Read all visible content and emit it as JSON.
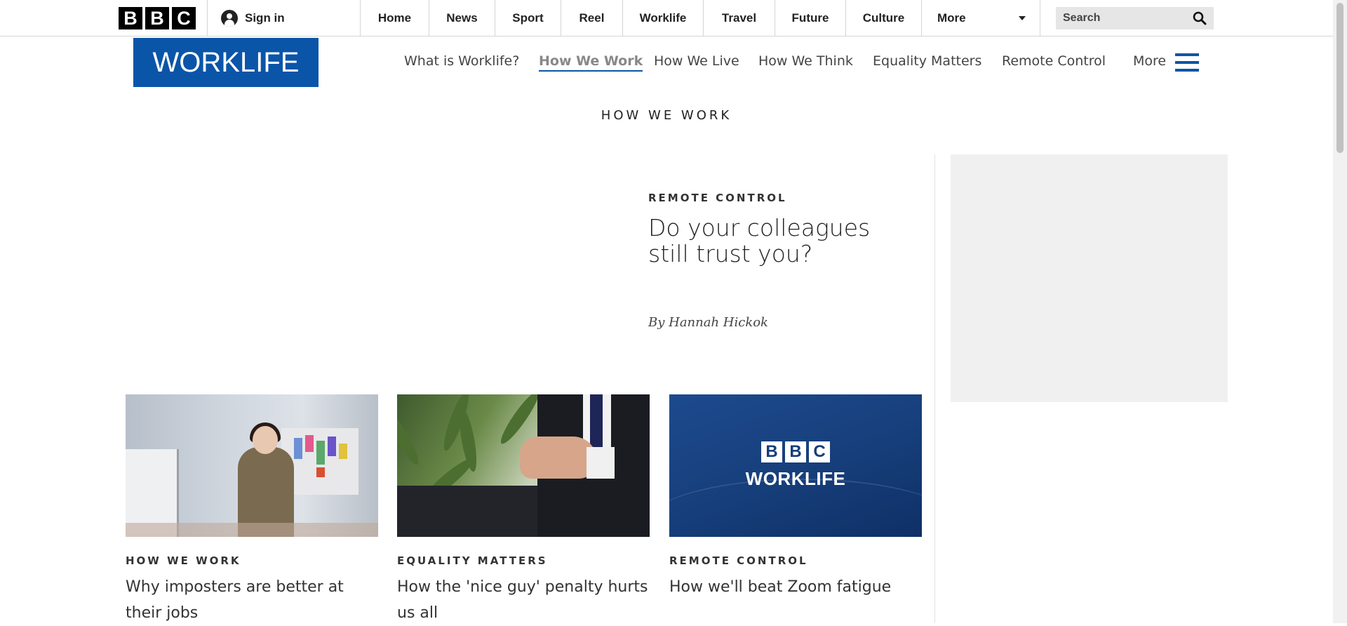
{
  "global_bar": {
    "logo_letters": [
      "B",
      "B",
      "C"
    ],
    "sign_in": "Sign in",
    "nav_items": [
      "Home",
      "News",
      "Sport",
      "Reel",
      "Worklife",
      "Travel",
      "Future",
      "Culture"
    ],
    "more": "More",
    "search_placeholder": "Search"
  },
  "worklife_nav": {
    "logo": "WORKLIFE",
    "items": [
      "What is Worklife?",
      "How We Work",
      "How We Live",
      "How We Think",
      "Equality Matters",
      "Remote Control"
    ],
    "active_item": "How We Work",
    "more": "More"
  },
  "section_title": "HOW WE WORK",
  "feature": {
    "kicker": "REMOTE CONTROL",
    "headline": "Do your colleagues still trust you?",
    "byline": "By Hannah Hickok"
  },
  "cards": [
    {
      "kicker": "HOW WE WORK",
      "title": "Why imposters are better at their jobs"
    },
    {
      "kicker": "EQUALITY MATTERS",
      "title": "How the 'nice guy' penalty hurts us all"
    },
    {
      "kicker": "REMOTE CONTROL",
      "title": "How we'll beat Zoom fatigue"
    }
  ],
  "card_logo": {
    "letters": [
      "B",
      "B",
      "C"
    ],
    "text": "WORKLIFE"
  },
  "colors": {
    "brand_blue": "#0a55a8",
    "ad_bg": "#f0f0f0"
  },
  "icons": {
    "search": "search-icon",
    "menu": "hamburger-icon",
    "user": "user-icon",
    "caret": "chevron-down-icon"
  }
}
